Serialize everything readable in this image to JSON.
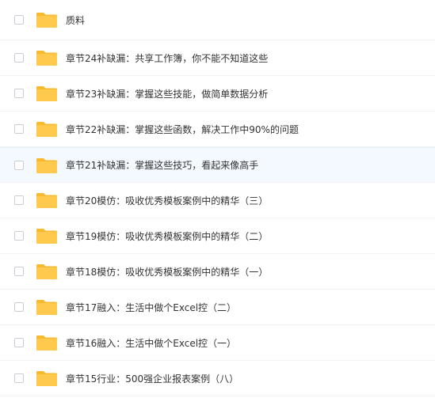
{
  "file_list": {
    "items": [
      {
        "name": "质料"
      },
      {
        "name": "章节24补缺漏：共享工作簿，你不能不知道这些"
      },
      {
        "name": "章节23补缺漏：掌握这些技能，做简单数据分析"
      },
      {
        "name": "章节22补缺漏：掌握这些函数，解决工作中90%的问题"
      },
      {
        "name": "章节21补缺漏：掌握这些技巧，看起来像高手"
      },
      {
        "name": "章节20模仿：吸收优秀模板案例中的精华（三）"
      },
      {
        "name": "章节19模仿：吸收优秀模板案例中的精华（二）"
      },
      {
        "name": "章节18模仿：吸收优秀模板案例中的精华（一）"
      },
      {
        "name": "章节17融入：生活中做个Excel控（二）"
      },
      {
        "name": "章节16融入：生活中做个Excel控（一）"
      },
      {
        "name": "章节15行业：500强企业报表案例（八）"
      }
    ],
    "hovered_index": 4
  },
  "colors": {
    "folder": "#ffc94d",
    "folder_tab": "#f7b92e",
    "hover_bg": "#f4f9ff",
    "text": "#333333"
  },
  "icons": {
    "folder": "folder-icon",
    "checkbox": "checkbox-icon"
  }
}
